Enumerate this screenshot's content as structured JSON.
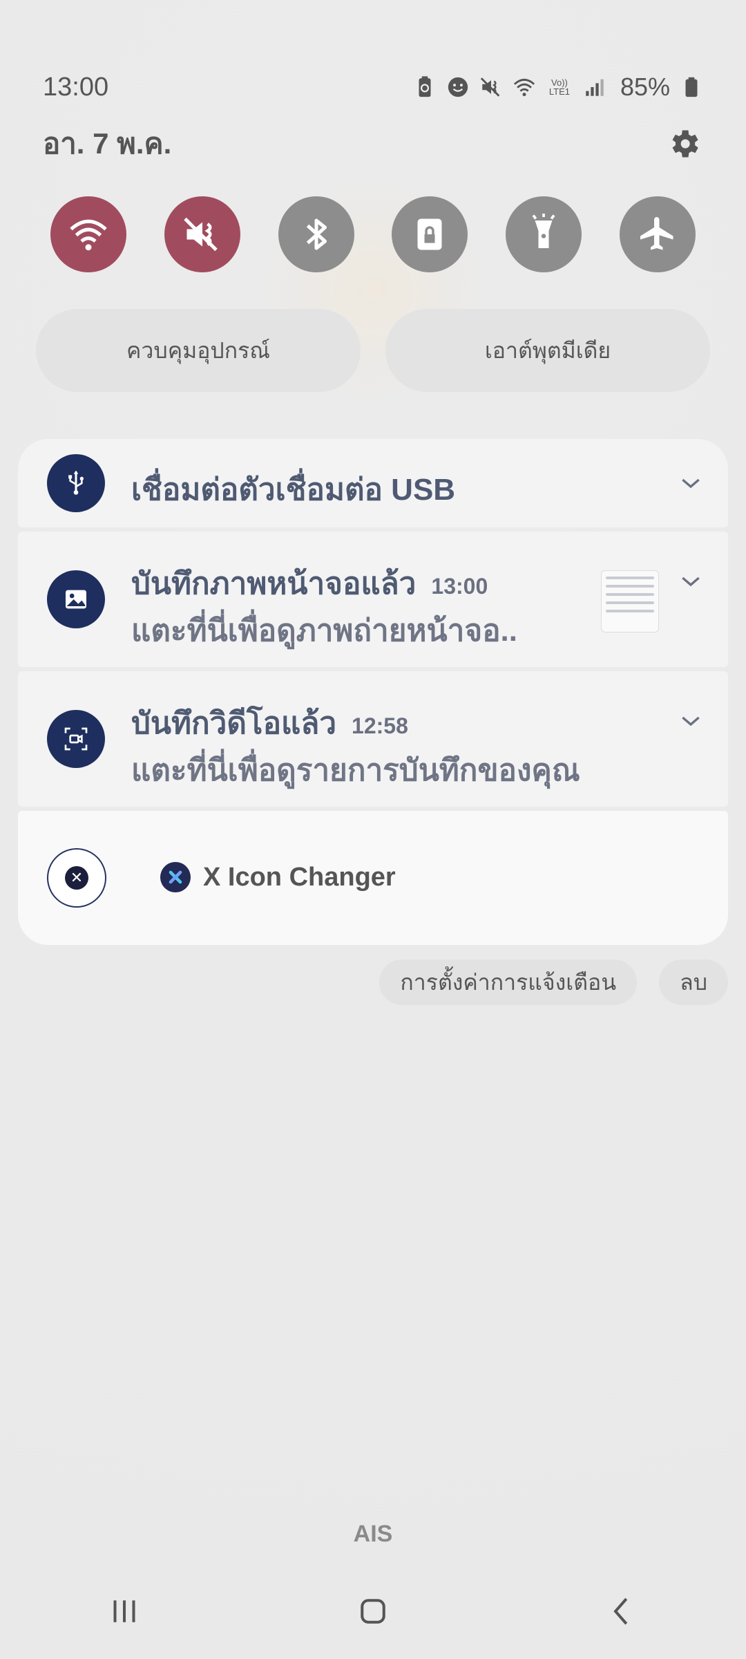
{
  "status_bar": {
    "time": "13:00",
    "icons": [
      "battery-saver-icon",
      "face-icon",
      "mute-icon",
      "wifi-icon",
      "volte-lte-icon",
      "signal-icon",
      "battery-icon"
    ],
    "network_label": "Vo)) LTE1",
    "battery": "85%"
  },
  "header": {
    "date": "อา. 7 พ.ค.",
    "settings_icon": "gear-icon"
  },
  "quick_settings": [
    {
      "name": "wifi",
      "icon": "wifi-icon",
      "active": true
    },
    {
      "name": "sound",
      "icon": "mute-icon",
      "active": true
    },
    {
      "name": "bluetooth",
      "icon": "bluetooth-icon",
      "active": false
    },
    {
      "name": "rotation-lock",
      "icon": "lock-icon",
      "active": false
    },
    {
      "name": "flashlight",
      "icon": "flashlight-icon",
      "active": false
    },
    {
      "name": "airplane",
      "icon": "airplane-icon",
      "active": false
    }
  ],
  "pills": {
    "device_control": "ควบคุมอุปกรณ์",
    "media_output": "เอาต์พุตมีเดีย"
  },
  "notifications": [
    {
      "icon": "usb-icon",
      "title": "เชื่อมต่อตัวเชื่อมต่อ USB"
    },
    {
      "icon": "image-icon",
      "title": "บันทึกภาพหน้าจอแล้ว",
      "time": "13:00",
      "text": "แตะที่นี่เพื่อดูภาพถ่ายหน้าจอ.."
    },
    {
      "icon": "screen-record-icon",
      "title": "บันทึกวิดีโอแล้ว",
      "time": "12:58",
      "text": "แตะที่นี่เพื่อดูรายการบันทึกของคุณ"
    },
    {
      "icon": "x-icon",
      "title": "X Icon Changer"
    }
  ],
  "actions": {
    "notification_settings": "การตั้งค่าการแจ้งเตือน",
    "clear": "ลบ"
  },
  "carrier": "AIS",
  "nav": [
    "recents-icon",
    "home-icon",
    "back-icon"
  ],
  "colors": {
    "accent_active": "#a14c5e",
    "tile_inactive": "#8d8d8d",
    "notif_icon_bg": "#1e2e5e"
  }
}
